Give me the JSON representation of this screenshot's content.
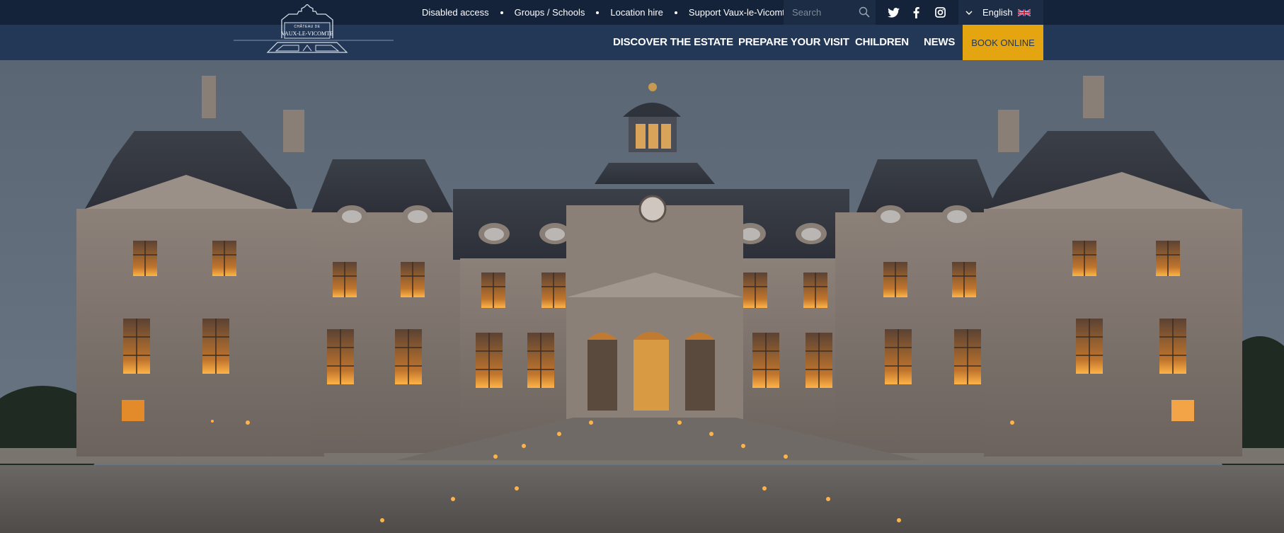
{
  "top_links": [
    "Disabled access",
    "Groups / Schools",
    "Location hire",
    "Support Vaux-le-Vicomte"
  ],
  "search": {
    "placeholder": "Search",
    "value": ""
  },
  "social_icons": [
    "twitter-icon",
    "facebook-icon",
    "instagram-icon"
  ],
  "language": {
    "label": "English",
    "flag": "uk-flag-icon"
  },
  "logo": {
    "line1": "CHÂTEAU DE",
    "line2": "VAUX-LE-VICOMTE"
  },
  "nav": {
    "items": [
      "DISCOVER THE ESTATE",
      "PREPARE YOUR VISIT",
      "CHILDREN",
      "NEWS"
    ],
    "book_online": "BOOK ONLINE"
  },
  "colors": {
    "topbar": "#142339",
    "navbar": "#233756",
    "accent": "#e5a511"
  }
}
